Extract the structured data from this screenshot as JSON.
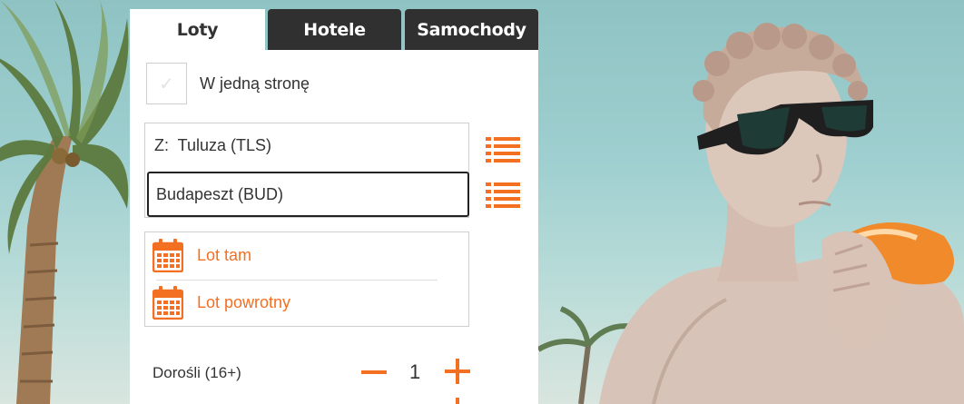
{
  "tabs": [
    {
      "label": "Loty",
      "active": true
    },
    {
      "label": "Hotele",
      "active": false
    },
    {
      "label": "Samochody",
      "active": false
    }
  ],
  "one_way": {
    "label": "W jedną stronę",
    "checked": false
  },
  "route": {
    "from_label": "Z:  Tuluza (TLS)",
    "to_value": "Budapeszt (BUD)"
  },
  "dates": {
    "outbound_label": "Lot tam",
    "return_label": "Lot powrotny"
  },
  "passengers": {
    "adults_label": "Dorośli (16+)",
    "adults_count": "1"
  },
  "colors": {
    "accent": "#f36f21",
    "tab_inactive": "#303030",
    "tab_active": "#ffffff"
  },
  "icons": [
    "check-icon",
    "list-icon",
    "calendar-icon",
    "minus-icon",
    "plus-icon"
  ]
}
